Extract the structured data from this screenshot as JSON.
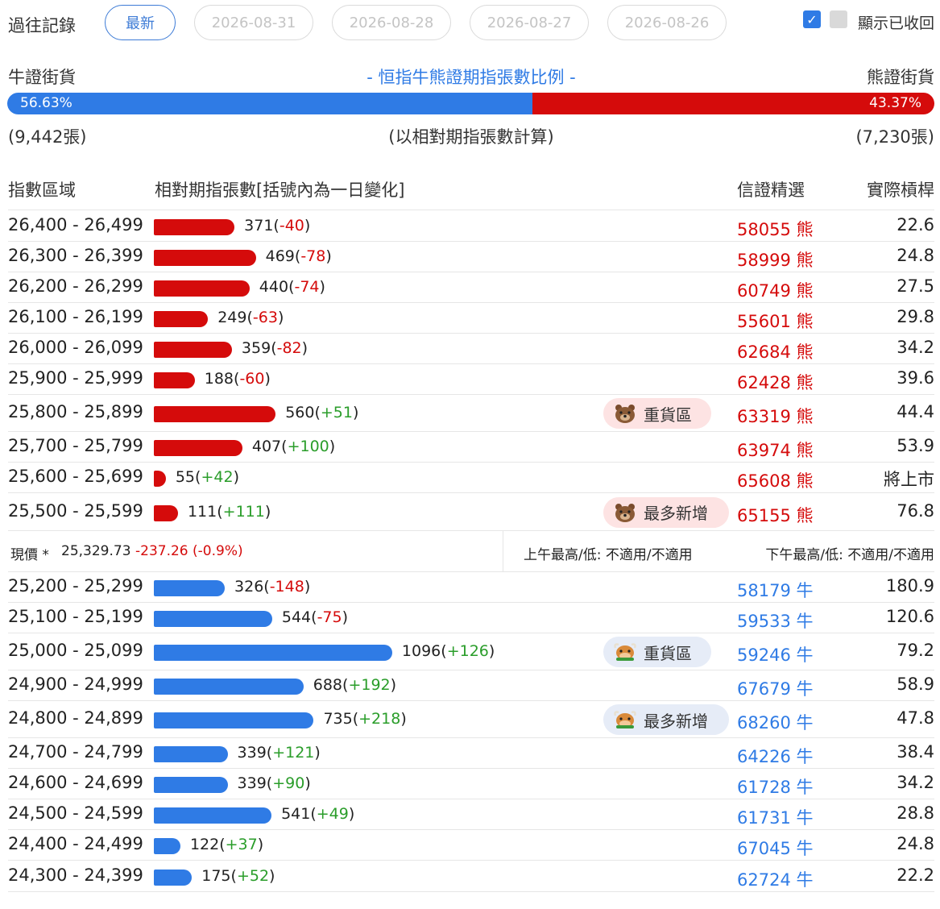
{
  "history": {
    "title": "過往記錄",
    "pills": [
      "最新",
      "2026-08-31",
      "2026-08-28",
      "2026-08-27",
      "2026-08-26"
    ],
    "show_recalled_label": "顯示已收回"
  },
  "ratio": {
    "bull_label": "牛證街貨",
    "bear_label": "熊證街貨",
    "title": "- 恒指牛熊證期指張數比例 -",
    "bull_pct": "56.63%",
    "bear_pct": "43.37%",
    "bull_fraction": 0.5663,
    "bull_count": "(9,442張)",
    "bear_count": "(7,230張)",
    "note": "(以相對期指張數計算)"
  },
  "columns": {
    "range": "指數區域",
    "contracts": "相對期指張數[括號內為一日變化]",
    "pick": "信證精選",
    "leverage": "實際槓桿"
  },
  "colors": {
    "bear": "#d50b0b",
    "bull": "#2f7be5",
    "pos": "#2a9d2a"
  },
  "bear_rows": [
    {
      "range": "26,400 - 26,499",
      "count": "371",
      "chg": "-40",
      "value": 371,
      "code": "58055 熊",
      "lev": "22.6"
    },
    {
      "range": "26,300 - 26,399",
      "count": "469",
      "chg": "-78",
      "value": 469,
      "code": "58999 熊",
      "lev": "24.8"
    },
    {
      "range": "26,200 - 26,299",
      "count": "440",
      "chg": "-74",
      "value": 440,
      "code": "60749 熊",
      "lev": "27.5"
    },
    {
      "range": "26,100 - 26,199",
      "count": "249",
      "chg": "-63",
      "value": 249,
      "code": "55601 熊",
      "lev": "29.8"
    },
    {
      "range": "26,000 - 26,099",
      "count": "359",
      "chg": "-82",
      "value": 359,
      "code": "62684 熊",
      "lev": "34.2"
    },
    {
      "range": "25,900 - 25,999",
      "count": "188",
      "chg": "-60",
      "value": 188,
      "code": "62428 熊",
      "lev": "39.6"
    },
    {
      "range": "25,800 - 25,899",
      "count": "560",
      "chg": "+51",
      "value": 560,
      "code": "63319 熊",
      "lev": "44.4",
      "badge": "重貨區"
    },
    {
      "range": "25,700 - 25,799",
      "count": "407",
      "chg": "+100",
      "value": 407,
      "code": "63974 熊",
      "lev": "53.9"
    },
    {
      "range": "25,600 - 25,699",
      "count": "55",
      "chg": "+42",
      "value": 55,
      "code": "65608 熊",
      "lev": "將上市"
    },
    {
      "range": "25,500 - 25,599",
      "count": "111",
      "chg": "+111",
      "value": 111,
      "code": "65155 熊",
      "lev": "76.8",
      "badge": "最多新增"
    }
  ],
  "spot": {
    "label": "現價 *",
    "value": "25,329.73",
    "change": "-237.26 (-0.9%)",
    "am": "上午最高/低: 不適用/不適用",
    "pm": "下午最高/低: 不適用/不適用"
  },
  "bull_rows": [
    {
      "range": "25,200 - 25,299",
      "count": "326",
      "chg": "-148",
      "value": 326,
      "code": "58179 牛",
      "lev": "180.9"
    },
    {
      "range": "25,100 - 25,199",
      "count": "544",
      "chg": "-75",
      "value": 544,
      "code": "59533 牛",
      "lev": "120.6"
    },
    {
      "range": "25,000 - 25,099",
      "count": "1096",
      "chg": "+126",
      "value": 1096,
      "code": "59246 牛",
      "lev": "79.2",
      "badge": "重貨區"
    },
    {
      "range": "24,900 - 24,999",
      "count": "688",
      "chg": "+192",
      "value": 688,
      "code": "67679 牛",
      "lev": "58.9"
    },
    {
      "range": "24,800 - 24,899",
      "count": "735",
      "chg": "+218",
      "value": 735,
      "code": "68260 牛",
      "lev": "47.8",
      "badge": "最多新增"
    },
    {
      "range": "24,700 - 24,799",
      "count": "339",
      "chg": "+121",
      "value": 339,
      "code": "64226 牛",
      "lev": "38.4"
    },
    {
      "range": "24,600 - 24,699",
      "count": "339",
      "chg": "+90",
      "value": 339,
      "code": "61728 牛",
      "lev": "34.2"
    },
    {
      "range": "24,500 - 24,599",
      "count": "541",
      "chg": "+49",
      "value": 541,
      "code": "61731 牛",
      "lev": "28.8"
    },
    {
      "range": "24,400 - 24,499",
      "count": "122",
      "chg": "+37",
      "value": 122,
      "code": "67045 牛",
      "lev": "24.8"
    },
    {
      "range": "24,300 - 24,399",
      "count": "175",
      "chg": "+52",
      "value": 175,
      "code": "62724 牛",
      "lev": "22.2"
    }
  ]
}
